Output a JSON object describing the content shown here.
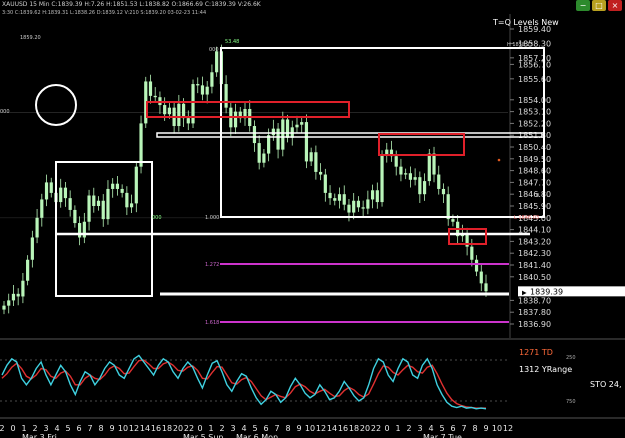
{
  "header": {
    "symbol_line": "XAUUSD 15 Min C:1839.39 H:7.26 H:1851.53 L:1838.82 O:1866.69 C:1839.39 V:26.6K",
    "subline": "3:30 C:1839.62 H:1839.31 L:1838.26 D:1839.12 V:210 S:1839.20 03-02-23 11:44",
    "window_buttons": [
      "green",
      "yellow",
      "red"
    ]
  },
  "indicator_title": "T=Q Levels New",
  "price_readout": "1859.20",
  "annotations": {
    "peak_label": "53.48",
    "box_top_left": "000",
    "box_top_right": "H 1858.13",
    "box_bottom_left": "1.000",
    "box_bottom_right": "L 1846.03",
    "left_small": "000",
    "left_box_label": "000",
    "lvl_1272": "1.272",
    "lvl_1618": "1.618",
    "right_zero": "0"
  },
  "oscillator": {
    "label_td": "1271 TD",
    "label_range": "1312 YRange",
    "label_sto": "STO 24,",
    "label_250": "250",
    "label_750": "750"
  },
  "colors": {
    "candle": "#b9f5b9",
    "white_level": "#ffffff",
    "red_box": "#e0202a",
    "magenta": "#cc33cc",
    "stoch_fast": "#3fd0e0",
    "stoch_slow": "#e03030",
    "label_td": "#ff6a3a"
  },
  "chart_data": {
    "type": "candlestick",
    "symbol": "XAUUSD",
    "timeframe": "15 Min",
    "y_ticks": [
      "1859.40",
      "1858.30",
      "1857.20",
      "1856.70",
      "1855.60",
      "1854.00",
      "1853.10",
      "1852.20",
      "1851.30",
      "1850.40",
      "1849.50",
      "1848.60",
      "1847.70",
      "1846.80",
      "1845.90",
      "1845.00",
      "1844.10",
      "1843.20",
      "1842.30",
      "1841.40",
      "1840.50",
      "1839.39",
      "1838.70",
      "1837.80",
      "1836.90"
    ],
    "current_price": "1839.39",
    "x_ticks": [
      "2",
      "0",
      "1",
      "2",
      "3",
      "4",
      "5",
      "6",
      "7",
      "8",
      "9",
      "10",
      "12",
      "14",
      "16",
      "18",
      "20",
      "22",
      "0",
      "1",
      "2",
      "3",
      "4",
      "5",
      "6",
      "7",
      "8",
      "9",
      "10",
      "12",
      "14",
      "16",
      "18",
      "20",
      "22",
      "0",
      "1",
      "2",
      "3",
      "4",
      "5",
      "6",
      "7",
      "8",
      "9",
      "10",
      "12"
    ],
    "date_labels": [
      "Mar 3 Fri",
      "Mar 5 Sun",
      "Mar 6 Mon",
      "Mar 7 Tue"
    ],
    "ylim": [
      1836.5,
      1860.0
    ],
    "close_path": [
      1838.3,
      1838.7,
      1839.2,
      1839.0,
      1840.2,
      1841.8,
      1843.5,
      1845.0,
      1846.4,
      1847.7,
      1846.9,
      1846.2,
      1847.3,
      1846.5,
      1845.6,
      1844.6,
      1843.5,
      1844.7,
      1846.7,
      1845.9,
      1846.3,
      1844.9,
      1847.2,
      1847.6,
      1847.2,
      1846.9,
      1845.8,
      1846.1,
      1848.9,
      1852.2,
      1855.4,
      1854.3,
      1854.2,
      1853.6,
      1852.9,
      1853.4,
      1852.0,
      1853.7,
      1852.6,
      1852.2,
      1855.2,
      1855.1,
      1854.4,
      1855.0,
      1856.1,
      1857.7,
      1855.2,
      1853.4,
      1851.9,
      1853.1,
      1852.6,
      1853.3,
      1852.0,
      1850.7,
      1849.2,
      1849.9,
      1851.3,
      1851.8,
      1850.2,
      1852.5,
      1851.1,
      1851.9,
      1852.1,
      1852.3,
      1849.3,
      1850.0,
      1848.5,
      1848.3,
      1846.9,
      1846.5,
      1846.3,
      1846.8,
      1846.0,
      1845.4,
      1846.3,
      1845.8,
      1845.7,
      1846.4,
      1847.1,
      1846.2,
      1849.8,
      1850.2,
      1849.7,
      1848.9,
      1848.3,
      1848.4,
      1847.9,
      1848.1,
      1846.8,
      1847.8,
      1849.9,
      1848.3,
      1847.2,
      1846.8,
      1844.9,
      1844.7,
      1843.6,
      1843.8,
      1842.8,
      1841.8,
      1840.9,
      1840.0,
      1839.4
    ],
    "osc_fast": [
      60,
      75,
      85,
      80,
      55,
      45,
      55,
      70,
      80,
      60,
      45,
      60,
      75,
      65,
      45,
      30,
      50,
      65,
      60,
      45,
      55,
      70,
      80,
      75,
      60,
      55,
      70,
      85,
      90,
      80,
      70,
      60,
      75,
      85,
      80,
      65,
      55,
      70,
      80,
      72,
      55,
      40,
      60,
      78,
      82,
      65,
      45,
      35,
      50,
      62,
      58,
      40,
      25,
      15,
      22,
      35,
      30,
      18,
      25,
      42,
      55,
      45,
      32,
      25,
      30,
      45,
      35,
      22,
      25,
      35,
      50,
      40,
      28,
      20,
      25,
      45,
      70,
      85,
      80,
      60,
      50,
      70,
      85,
      80,
      60,
      55,
      75,
      85,
      70,
      45,
      30,
      18,
      12,
      10,
      12,
      9,
      10,
      8,
      9,
      8
    ],
    "osc_slow": [
      55,
      62,
      72,
      78,
      70,
      58,
      54,
      60,
      70,
      68,
      58,
      55,
      63,
      66,
      58,
      45,
      45,
      55,
      60,
      55,
      53,
      60,
      70,
      74,
      70,
      62,
      63,
      73,
      82,
      83,
      77,
      70,
      70,
      77,
      80,
      75,
      67,
      66,
      72,
      74,
      67,
      55,
      54,
      64,
      73,
      72,
      60,
      48,
      46,
      53,
      56,
      50,
      39,
      28,
      22,
      26,
      30,
      27,
      25,
      32,
      42,
      46,
      42,
      35,
      31,
      35,
      38,
      32,
      27,
      28,
      36,
      41,
      37,
      30,
      26,
      31,
      46,
      62,
      74,
      72,
      64,
      60,
      68,
      75,
      72,
      65,
      63,
      72,
      75,
      62,
      46,
      32,
      22,
      16,
      13,
      11,
      10,
      9,
      9,
      9
    ]
  }
}
